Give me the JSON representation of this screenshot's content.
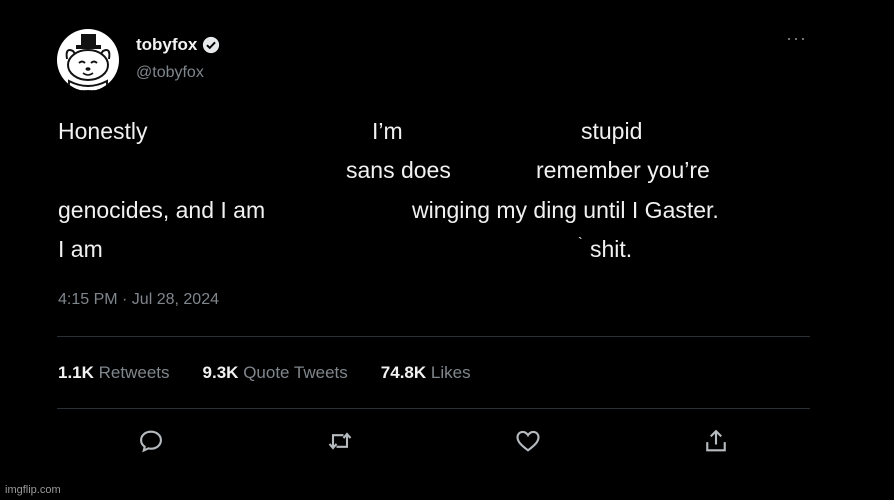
{
  "author": {
    "display_name": "tobyfox",
    "handle": "@tobyfox",
    "avatar": "avatar-dog-with-top-hat-icon",
    "verified_icon": "verified-badge-icon"
  },
  "more_icon": "···",
  "tweet": {
    "words": [
      "Honestly",
      "I’m",
      "stupid",
      "sans does",
      "remember you’re",
      "genocides, and I am",
      "winging my ding until I Gaster.",
      "I am",
      "`",
      "shit."
    ]
  },
  "timestamp": "4:15 PM · Jul 28, 2024",
  "stats": {
    "retweets_count": "1.1K",
    "retweets_label": "Retweets",
    "quotes_count": "9.3K",
    "quotes_label": "Quote Tweets",
    "likes_count": "74.8K",
    "likes_label": "Likes"
  },
  "actions": [
    "reply-icon",
    "retweet-icon",
    "like-icon",
    "share-icon"
  ],
  "watermark": "imgflip.com",
  "colors": {
    "background": "#000000",
    "text": "#f1f1f1",
    "secondary": "#7f868c",
    "divider": "#2a2f33"
  }
}
